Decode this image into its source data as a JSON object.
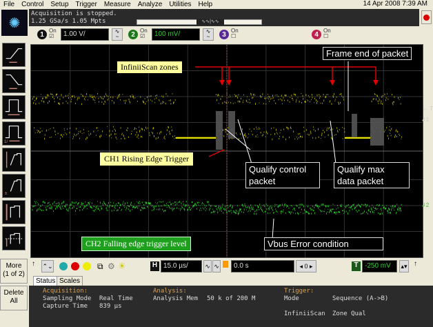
{
  "menu": [
    "File",
    "Control",
    "Setup",
    "Trigger",
    "Measure",
    "Analyze",
    "Utilities",
    "Help"
  ],
  "datetime": "14 Apr 2008 7:39 AM",
  "acquisition": {
    "state": "Acquisition is stopped.",
    "rate": "1.25 GSa/s   1.05 Mpts"
  },
  "channels": [
    {
      "num": "1",
      "on": "On",
      "scale": "1.00 V/",
      "color": "#e8e000",
      "checked": true
    },
    {
      "num": "2",
      "on": "On",
      "scale": "100 mV/",
      "color": "#28c828",
      "checked": true
    },
    {
      "num": "3",
      "on": "On",
      "color": "#7a3fc0",
      "checked": false
    },
    {
      "num": "4",
      "on": "On",
      "color": "#d03060",
      "checked": false
    }
  ],
  "sidebar": {
    "more": "More",
    "more_page": "(1 of 2)",
    "delete": "Delete",
    "delete2": "All"
  },
  "annotations": {
    "zones": "InfiniiScan zones",
    "frame_end": "Frame end of packet",
    "ch1_trigger": "CH1 Rising Edge Trigger",
    "qual_ctrl_1": "Qualify control",
    "qual_ctrl_2": "packet",
    "qual_max_1": "Qualify max",
    "qual_max_2": "data packet",
    "ch2_trigger": "CH2 Falling edge trigger level",
    "vbus": "Vbus Error condition"
  },
  "markers": {
    "t": "T",
    "ch1": "1",
    "ch2": "2"
  },
  "controls": {
    "h_label": "H",
    "timebase": "15.0 µs/",
    "delay": "0.0 s",
    "delay_ref": "0",
    "t_label": "T",
    "trigger_level": "-250 mV"
  },
  "tabs": [
    "Status",
    "Scales"
  ],
  "status": {
    "acq_title": "Acquisition:",
    "sampling_mode_label": "Sampling Mode",
    "sampling_mode": "Real Time",
    "capture_label": "Capture Time",
    "capture": "839 µs",
    "analysis_title": "Analysis:",
    "mem_label": "Analysis Mem",
    "mem": "50 k of 200 M",
    "trigger_title": "Trigger:",
    "mode_label": "Mode",
    "mode": "Sequence (A->B)",
    "iscan_label": "InfiniiScan",
    "iscan": "Zone Qual"
  },
  "colors": {
    "ch1": "#e8e000",
    "ch2": "#28c828",
    "zone": "#555555",
    "arrow": "#e00000"
  }
}
